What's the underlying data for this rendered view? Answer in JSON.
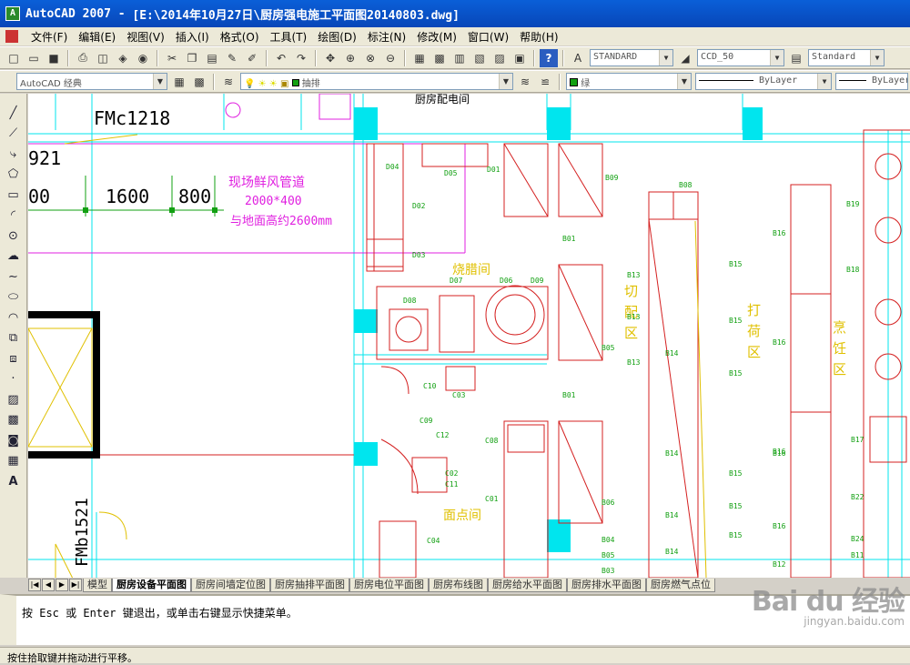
{
  "title_bar": {
    "app": "AutoCAD 2007",
    "separator": " - ",
    "file_path": "[E:\\2014年10月27日\\厨房强电施工平面图20140803.dwg]"
  },
  "menu": {
    "items": [
      "文件(F)",
      "编辑(E)",
      "视图(V)",
      "插入(I)",
      "格式(O)",
      "工具(T)",
      "绘图(D)",
      "标注(N)",
      "修改(M)",
      "窗口(W)",
      "帮助(H)"
    ]
  },
  "toolbar": {
    "text_style": "STANDARD",
    "dim_style": "CCD_50",
    "table_style": "Standard",
    "workspace": "AutoCAD 经典",
    "layer": "抽排",
    "color": "绿",
    "linetype": "ByLayer",
    "lineweight": "ByLayer"
  },
  "drawing": {
    "door_label_1": "FMc1218",
    "door_label_2": "FMb1521",
    "dim_921": "921",
    "dim_00": "00",
    "dim_1600": "1600",
    "dim_800": "800",
    "note_line1": "现场鲜风管道",
    "note_line2": "2000*400",
    "note_line3": "与地面高约2600mm",
    "room_top": "厨房配电间",
    "room_baking": "烧腊间",
    "room_cut": [
      "切",
      "配",
      "区"
    ],
    "room_pack": [
      "打",
      "荷",
      "区"
    ],
    "room_cook": [
      "烹",
      "饪",
      "区"
    ],
    "room_pastry": "面点间",
    "codes": [
      "D04",
      "D05",
      "D01",
      "B09",
      "D02",
      "B08",
      "D03",
      "B01",
      "B19",
      "B16",
      "B15",
      "B18",
      "B13",
      "B16",
      "B16",
      "B15",
      "D08",
      "D07",
      "D06",
      "D09",
      "B13",
      "B05",
      "B14",
      "B15",
      "C10",
      "C03",
      "B01",
      "C09",
      "C12",
      "C08",
      "B16",
      "B14",
      "B15",
      "B17",
      "C02",
      "C11",
      "C01",
      "B06",
      "B14",
      "B15",
      "B16",
      "B22",
      "C04",
      "B04",
      "B05",
      "B14",
      "B15",
      "B24",
      "B03",
      "B13",
      "B11",
      "B12"
    ]
  },
  "tabs": {
    "items": [
      "模型",
      "厨房设备平面图",
      "厨房间墙定位图",
      "厨房抽排平面图",
      "厨房电位平面图",
      "厨房布线图",
      "厨房给水平面图",
      "厨房排水平面图",
      "厨房燃气点位"
    ],
    "active_index": 1
  },
  "command_line": {
    "text": "按 Esc 或 Enter 键退出，或单击右键显示快捷菜单。"
  },
  "status_bar": {
    "text": "按住拾取键并拖动进行平移。"
  },
  "watermark": {
    "logo": "Bai du 经验",
    "url": "jingyan.baidu.com"
  },
  "colors": {
    "title_blue": "#0a5fd8",
    "cad_red": "#d42020",
    "cad_cyan": "#00e5ee",
    "cad_magenta": "#e020e0",
    "cad_green": "#12a012",
    "cad_yellow": "#e0c000"
  }
}
